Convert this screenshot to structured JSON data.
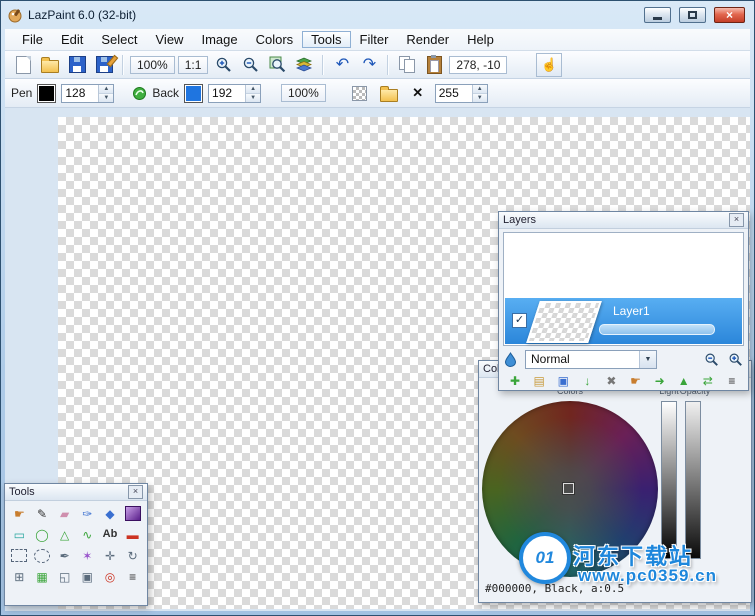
{
  "glyphs": {
    "up": "▲",
    "down": "▼",
    "dropdown": "▼",
    "check": "✓",
    "close_x": "×",
    "undo": "↶",
    "redo": "↷",
    "hand": "☝",
    "clear": "✕",
    "marker": "◀"
  },
  "window": {
    "title": "LazPaint 6.0 (32-bit)"
  },
  "menu": {
    "items": [
      "File",
      "Edit",
      "Select",
      "View",
      "Image",
      "Colors",
      "Tools",
      "Filter",
      "Render",
      "Help"
    ]
  },
  "toolbar": {
    "zoom": "100%",
    "one_to_one": "1:1",
    "coords": "278, -10"
  },
  "penbar": {
    "pen_label": "Pen",
    "pen_width": "128",
    "back_label": "Back",
    "back_width": "192",
    "opacity": "100%",
    "texture_alpha": "255"
  },
  "layers_panel": {
    "title": "Layers",
    "layer_name": "Layer1",
    "blend_mode": "Normal",
    "icons": [
      {
        "name": "add-layer",
        "glyph": "✚"
      },
      {
        "name": "open-layer",
        "glyph": "▤"
      },
      {
        "name": "duplicate-layer",
        "glyph": "▣"
      },
      {
        "name": "merge-layer-down",
        "glyph": "↓"
      },
      {
        "name": "delete-layer",
        "glyph": "✖"
      },
      {
        "name": "move-layer-tool",
        "glyph": "☛"
      },
      {
        "name": "shift-layer",
        "glyph": "➜"
      },
      {
        "name": "raise-layer",
        "glyph": "▲"
      },
      {
        "name": "flip-layer",
        "glyph": "⇄"
      },
      {
        "name": "layer-options",
        "glyph": "≡"
      }
    ]
  },
  "colors_panel": {
    "title": "Colors",
    "colors_label": "Colors",
    "light_label": "Light",
    "opacity_label": "Opacity",
    "value_text": "#000000, Black, a:0.5"
  },
  "tools_panel": {
    "title": "Tools",
    "tools": [
      {
        "name": "tool-hand",
        "glyph": "☛"
      },
      {
        "name": "tool-pencil",
        "glyph": "✎"
      },
      {
        "name": "tool-eraser",
        "glyph": "▰"
      },
      {
        "name": "tool-brush",
        "glyph": "✑"
      },
      {
        "name": "tool-floodfill",
        "glyph": "◆"
      },
      {
        "name": "tool-gradient",
        "glyph": ""
      },
      {
        "name": "tool-rectangle",
        "glyph": "▭"
      },
      {
        "name": "tool-ellipse",
        "glyph": "◯"
      },
      {
        "name": "tool-polygon",
        "glyph": "△"
      },
      {
        "name": "tool-curve",
        "glyph": "∿"
      },
      {
        "name": "tool-text",
        "glyph": "Ab"
      },
      {
        "name": "tool-filled-rect",
        "glyph": "▬"
      },
      {
        "name": "tool-select-rect",
        "glyph": ""
      },
      {
        "name": "tool-select-ellipse",
        "glyph": ""
      },
      {
        "name": "tool-select-pen",
        "glyph": "✒"
      },
      {
        "name": "tool-magic-wand",
        "glyph": "✶"
      },
      {
        "name": "tool-move-selection",
        "glyph": "✛"
      },
      {
        "name": "tool-rotate-selection",
        "glyph": "↻"
      },
      {
        "name": "tool-deformation-grid",
        "glyph": "⊞"
      },
      {
        "name": "tool-texture-mapping",
        "glyph": "▦"
      },
      {
        "name": "tool-perspective",
        "glyph": "◱"
      },
      {
        "name": "tool-clone",
        "glyph": "▣"
      },
      {
        "name": "tool-color-picker",
        "glyph": "◎"
      },
      {
        "name": "tool-adjust",
        "glyph": "≡"
      }
    ]
  },
  "watermark": {
    "logo_text": "01",
    "site_name": "河东下载站",
    "site_url": "www.pc0359.cn"
  }
}
